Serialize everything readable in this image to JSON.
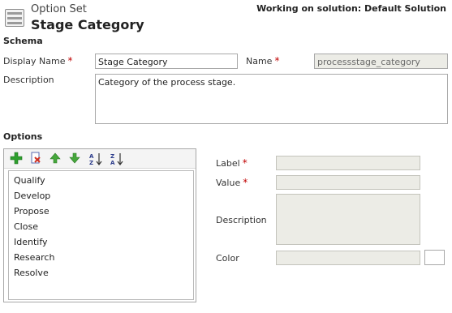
{
  "header": {
    "entity_type": "Option Set",
    "entity_name": "Stage Category",
    "solution_label": "Working on solution: Default Solution"
  },
  "schema": {
    "section_title": "Schema",
    "display_name_label": "Display Name",
    "display_name_value": "Stage Category",
    "name_label": "Name",
    "name_value": "processstage_category",
    "description_label": "Description",
    "description_value": "Category of the process stage.",
    "required_marker": "*"
  },
  "options": {
    "section_title": "Options",
    "toolbar": [
      "add-icon",
      "delete-icon",
      "move-up-icon",
      "move-down-icon",
      "sort-ascending-icon",
      "sort-descending-icon"
    ],
    "items": [
      "Qualify",
      "Develop",
      "Propose",
      "Close",
      "Identify",
      "Research",
      "Resolve"
    ]
  },
  "option_details": {
    "label_label": "Label",
    "value_label": "Value",
    "description_label": "Description",
    "color_label": "Color",
    "required_marker": "*"
  },
  "colors": {
    "required": "#c00000",
    "add_icon": "#2ea02e",
    "move_icon": "#46a83c",
    "disabled_field": "#ecece6"
  }
}
